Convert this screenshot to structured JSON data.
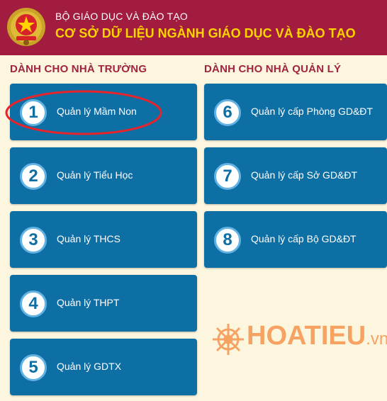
{
  "header": {
    "ministry": "BỘ GIÁO DỤC VÀ ĐÀO TẠO",
    "title": "CƠ SỞ DỮ LIỆU NGÀNH GIÁO DỤC VÀ ĐÀO TẠO"
  },
  "columns": {
    "schools": {
      "title": "DÀNH CHO NHÀ TRƯỜNG"
    },
    "managers": {
      "title": "DÀNH CHO NHÀ QUẢN LÝ"
    }
  },
  "cards": [
    {
      "number": "1",
      "label": "Quản lý Mầm Non"
    },
    {
      "number": "2",
      "label": "Quản lý Tiểu Học"
    },
    {
      "number": "3",
      "label": "Quản lý THCS"
    },
    {
      "number": "4",
      "label": "Quản lý THPT"
    },
    {
      "number": "5",
      "label": "Quản lý GDTX"
    },
    {
      "number": "6",
      "label": "Quản lý cấp Phòng GD&ĐT"
    },
    {
      "number": "7",
      "label": "Quản lý cấp Sở GD&ĐT"
    },
    {
      "number": "8",
      "label": "Quản lý cấp Bộ GD&ĐT"
    }
  ],
  "watermark": {
    "brand": "HOATIEU",
    "suffix": ".vn"
  },
  "colors": {
    "header_bg": "#a11c3f",
    "title_yellow": "#ffd400",
    "card_blue": "#0e6fa5",
    "page_bg": "#fcf6df",
    "highlight_red": "#e8232a",
    "watermark_orange": "#f59a55"
  },
  "icons": {
    "emblem": "national-emblem-icon",
    "watermark": "ship-wheel-icon"
  }
}
